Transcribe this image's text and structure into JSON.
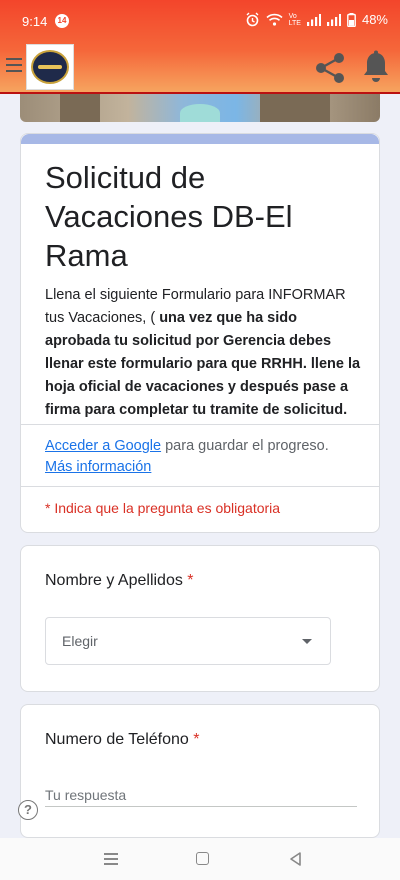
{
  "status_bar": {
    "time": "9:14",
    "notification_count": "14",
    "network_label_top": "Vo",
    "network_label_bottom": "LTE",
    "battery": "48%",
    "icons": [
      "alarm-icon",
      "wifi-icon",
      "signal-icon",
      "signal-icon",
      "battery-icon"
    ]
  },
  "app_header": {
    "icons": [
      "menu-icon",
      "logo",
      "share-icon",
      "bell-icon"
    ],
    "colors": {
      "gradient_top": "#f3452b",
      "gradient_bottom": "#f6a45f",
      "icon_color": "#555555"
    }
  },
  "form": {
    "title": "Solicitud de Vacaciones DB-El Rama",
    "description_plain": "Llena el siguiente Formulario para INFORMAR tus  Vacaciones, ( ",
    "description_bold": "una vez que ha sido  aprobada tu solicitud por Gerencia debes llenar este formulario para que RRHH. llene la hoja oficial de vacaciones y después pase a firma para completar tu tramite de solicitud.",
    "signin_link": "Acceder a Google",
    "signin_suffix": " para guardar el progreso.",
    "more_info_link": "Más información",
    "required_note": "* Indica que la pregunta es obligatoria",
    "accent_color": "#a7b8e6"
  },
  "questions": [
    {
      "label": "Nombre y Apellidos",
      "required_mark": "*",
      "type": "dropdown",
      "selected_value": "Elegir"
    },
    {
      "label": "Numero de Teléfono",
      "required_mark": "*",
      "type": "text",
      "placeholder": "Tu respuesta"
    }
  ],
  "help": {
    "icon": "help-icon",
    "symbol": "?"
  },
  "nav_bar": {
    "icons": [
      "recents-icon",
      "home-icon",
      "back-icon"
    ]
  }
}
